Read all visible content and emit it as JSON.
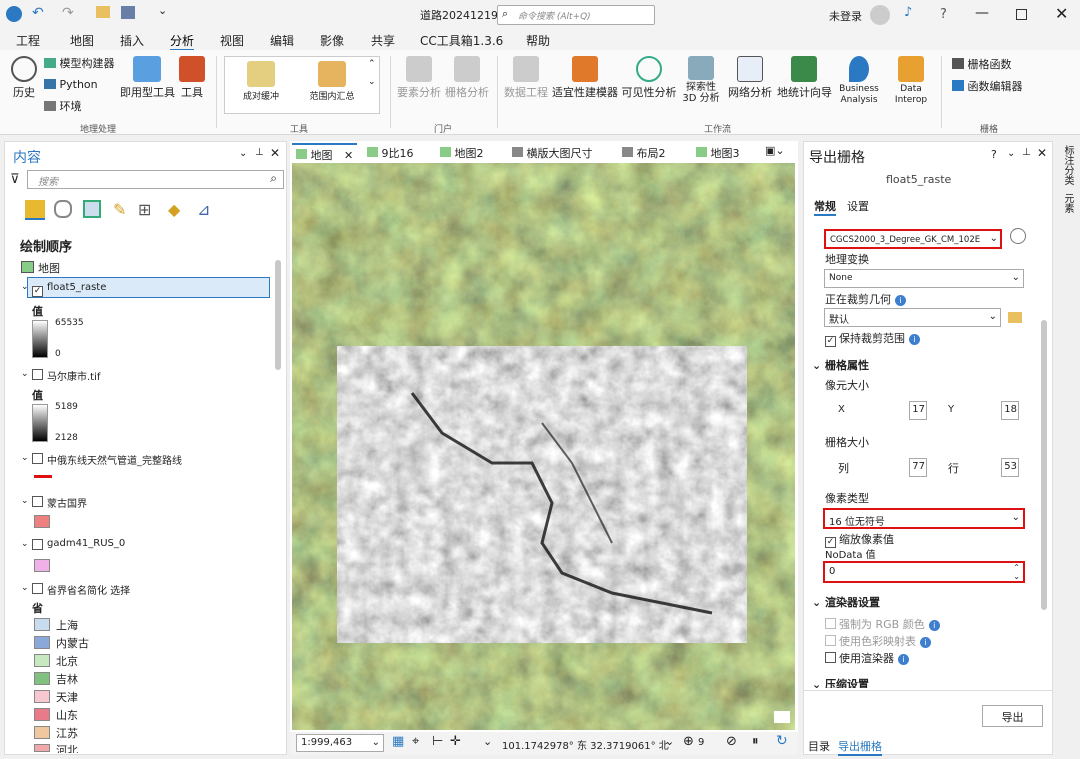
{
  "titlebar": {
    "doc_title": "道路20241219",
    "search_placeholder": "命令搜索 (Alt+Q)",
    "signin": "未登录",
    "help": "?"
  },
  "ribbon_tabs": [
    "工程",
    "地图",
    "插入",
    "分析",
    "视图",
    "编辑",
    "影像",
    "共享",
    "CC工具箱1.3.6",
    "帮助"
  ],
  "active_tab": "分析",
  "ribbon": {
    "history": "历史",
    "modelbuilder": "模型构建器",
    "python": "Python",
    "environments": "环境",
    "ready_tools": "即用型工具",
    "tools": "工具",
    "group_geoproc": "地理处理",
    "gallery": [
      "成对缓冲",
      "范围内汇总"
    ],
    "group_tools": "工具",
    "feature_analysis": "要素分析",
    "raster_analysis": "栅格分析",
    "group_portal": "门户",
    "data_engineering": "数据工程",
    "suitability": "适宜性建模器",
    "visibility": "可见性分析",
    "exploratory_3d": "探索性 3D 分析",
    "network": "网络分析",
    "geocomputation": "地统计向导",
    "business_analysis": "Business Analysis",
    "data_interop": "Data Interop",
    "group_workflow": "工作流",
    "raster_functions": "栅格函数",
    "function_editor": "函数编辑器",
    "group_raster": "栅格"
  },
  "contents": {
    "title": "内容",
    "search_placeholder": "搜索",
    "drawing_order": "绘制顺序",
    "map": "地图",
    "layers": [
      {
        "name": "float5_raste",
        "checked": true,
        "value_label": "值",
        "max": "65535",
        "min": "0"
      },
      {
        "name": "马尔康市.tif",
        "checked": false,
        "value_label": "值",
        "max": "5189",
        "min": "2128"
      },
      {
        "name": "中俄东线天然气管道_完整路线",
        "checked": false
      },
      {
        "name": "蒙古国界",
        "checked": false
      },
      {
        "name": "gadm41_RUS_0",
        "checked": false
      },
      {
        "name": "省界省名简化 选择",
        "checked": false,
        "field": "省"
      }
    ],
    "provinces": [
      "上海",
      "内蒙古",
      "北京",
      "吉林",
      "天津",
      "山东",
      "江苏",
      "河北"
    ]
  },
  "map_tabs": [
    "地图",
    "9比16",
    "地图2",
    "横版大图尺寸",
    "布局2",
    "地图3"
  ],
  "statusbar": {
    "scale": "1:999,463",
    "coords": "101.1742978° 东 32.3719061° 北",
    "selected": "9"
  },
  "export": {
    "title": "导出栅格",
    "subtitle": "float5_raste",
    "tab_general": "常规",
    "tab_settings": "设置",
    "coord_system": "CGCS2000_3_Degree_GK_CM_102E",
    "geo_transform_label": "地理变换",
    "geo_transform": "None",
    "clip_label": "正在裁剪几何",
    "clip_value": "默认",
    "keep_clip": "保持裁剪范围",
    "raster_props": "栅格属性",
    "cell_size": "像元大小",
    "x": "X",
    "y": "Y",
    "cell_x": "17",
    "cell_y": "18",
    "raster_size": "栅格大小",
    "cols": "列",
    "rows": "行",
    "col_val": "77",
    "row_val": "53",
    "pixel_type_label": "像素类型",
    "pixel_type": "16 位无符号",
    "scale_pixels": "缩放像素值",
    "nodata_label": "NoData 值",
    "nodata": "0",
    "renderer_settings": "渲染器设置",
    "force_rgb": "强制为 RGB 颜色",
    "use_colormap": "使用色彩映射表",
    "use_renderer": "使用渲染器",
    "compression": "压缩设置",
    "export_btn": "导出",
    "bottom_tabs": [
      "目录",
      "导出栅格"
    ]
  },
  "right_strip": [
    "标注分类",
    "元素"
  ],
  "colors": {
    "accent": "#2b79c2",
    "highlight": "#d11111"
  }
}
